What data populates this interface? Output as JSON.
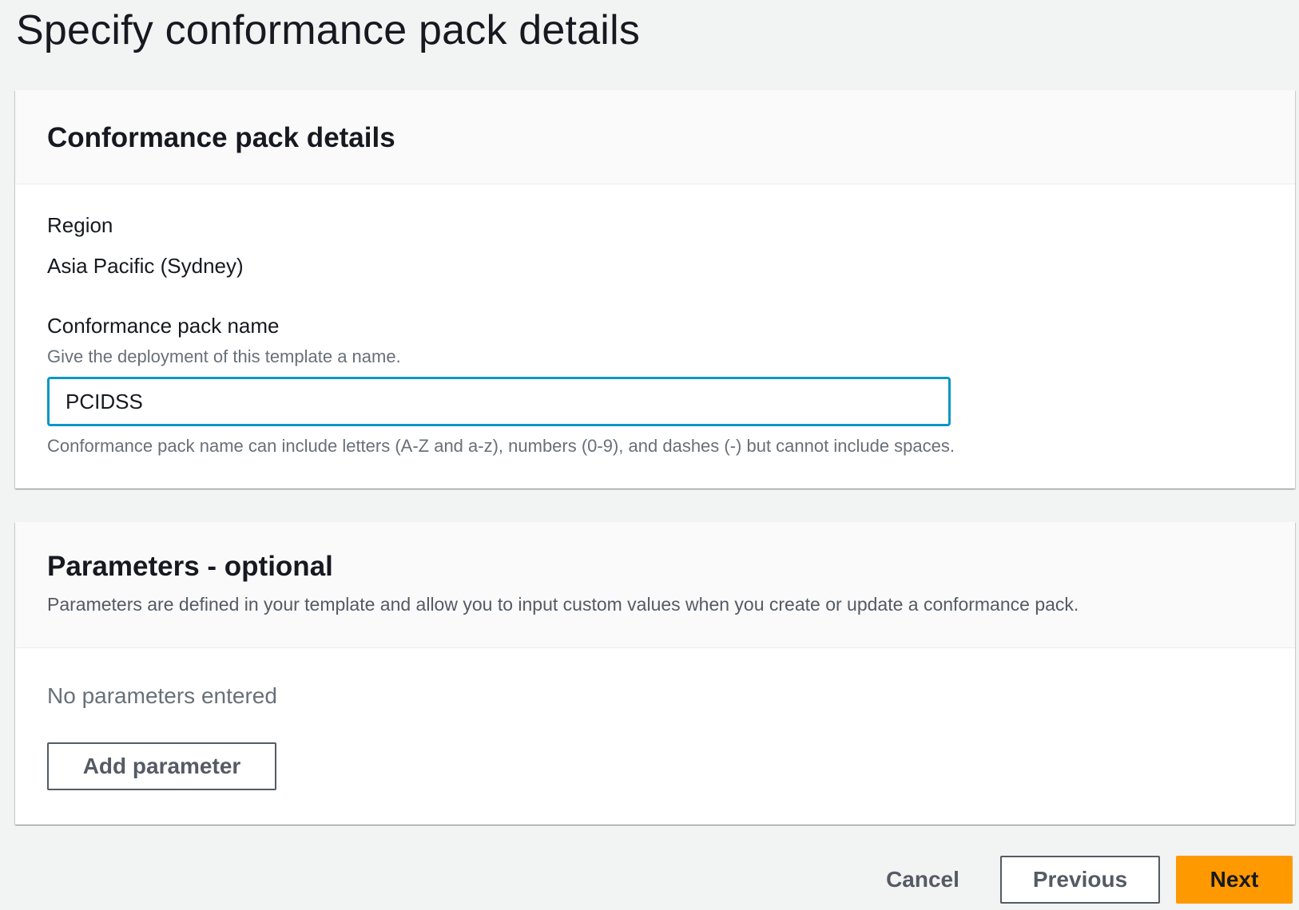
{
  "page": {
    "title": "Specify conformance pack details"
  },
  "details": {
    "title": "Conformance pack details",
    "region_label": "Region",
    "region_value": "Asia Pacific (Sydney)",
    "name_label": "Conformance pack name",
    "name_description": "Give the deployment of this template a name.",
    "name_value": "PCIDSS",
    "name_constraint": "Conformance pack name can include letters (A-Z and a-z), numbers (0-9), and dashes (-) but cannot include spaces."
  },
  "parameters": {
    "title": "Parameters - optional",
    "description": "Parameters are defined in your template and allow you to input custom values when you create or update a conformance pack.",
    "empty_text": "No parameters entered",
    "add_label": "Add parameter"
  },
  "actions": {
    "cancel_label": "Cancel",
    "previous_label": "Previous",
    "next_label": "Next"
  },
  "colors": {
    "accent": "#ff9900",
    "focus": "#0a97c5",
    "background": "#f2f3f3"
  }
}
